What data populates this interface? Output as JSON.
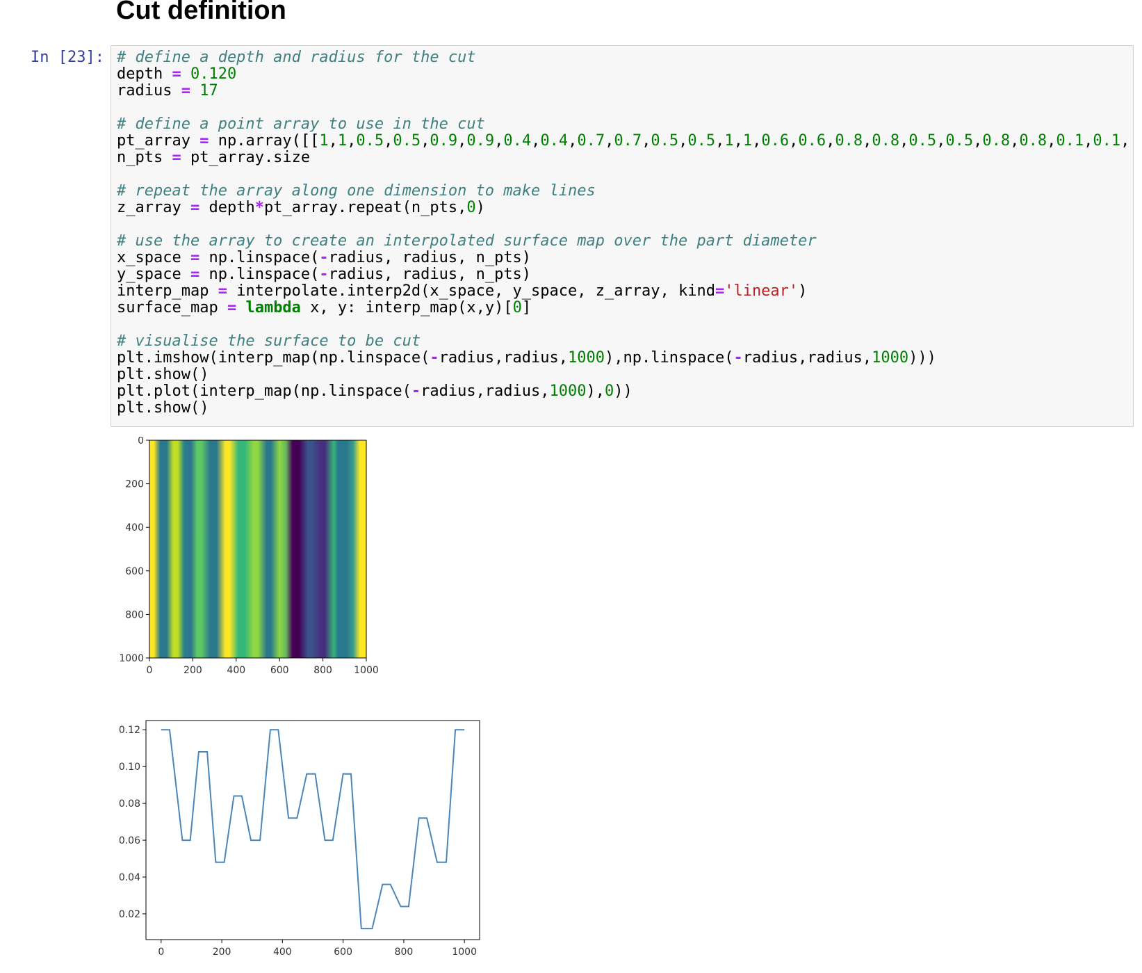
{
  "heading": "Cut definition",
  "prompt": "In [23]:",
  "code": {
    "l1": "# define a depth and radius for the cut",
    "l2": {
      "var": "depth",
      "eq": "=",
      "val": "0.120"
    },
    "l3": {
      "var": "radius",
      "eq": "=",
      "val": "17"
    },
    "l5": "# define a point array to use in the cut",
    "l6": {
      "a": "pt_array ",
      "eq": "=",
      "b": " np.array([[",
      "nums": [
        "1",
        "1",
        "0.5",
        "0.5",
        "0.9",
        "0.9",
        "0.4",
        "0.4",
        "0.7",
        "0.7",
        "0.5",
        "0.5",
        "1",
        "1",
        "0.6",
        "0.6",
        "0.8",
        "0.8",
        "0.5",
        "0.5",
        "0.8",
        "0.8",
        "0.1",
        "0.1",
        ""
      ]
    },
    "l7": {
      "a": "n_pts ",
      "eq": "=",
      "b": " pt_array.size"
    },
    "l9": "# repeat the array along one dimension to make lines",
    "l10": {
      "a": "z_array ",
      "eq": "=",
      "b": " depth",
      "op": "*",
      "c": "pt_array.repeat(n_pts,",
      "n": "0",
      "d": ")"
    },
    "l12": "# use the array to create an interpolated surface map over the part diameter",
    "l13": {
      "a": "x_space ",
      "eq": "=",
      "b": " np.linspace(",
      "m": "-",
      "c": "radius, radius, n_pts)"
    },
    "l14": {
      "a": "y_space ",
      "eq": "=",
      "b": " np.linspace(",
      "m": "-",
      "c": "radius, radius, n_pts)"
    },
    "l15": {
      "a": "interp_map ",
      "eq": "=",
      "b": " interpolate.interp2d(x_space, y_space, z_array, kind",
      "eq2": "=",
      "s": "'linear'",
      "c": ")"
    },
    "l16": {
      "a": "surface_map ",
      "eq": "=",
      "sp": " ",
      "k": "lambda",
      "b": " x, y: interp_map(x,y)[",
      "n": "0",
      "c": "]"
    },
    "l18": "# visualise the surface to be cut",
    "l19": {
      "a": "plt.imshow(interp_map(np.linspace(",
      "m1": "-",
      "b": "radius,radius,",
      "n1": "1000",
      "c": "),np.linspace(",
      "m2": "-",
      "d": "radius,radius,",
      "n2": "1000",
      "e": ")))"
    },
    "l20": "plt.show()",
    "l21": {
      "a": "plt.plot(interp_map(np.linspace(",
      "m": "-",
      "b": "radius,radius,",
      "n1": "1000",
      "c": "),",
      "n2": "0",
      "d": "))"
    },
    "l22": "plt.show()"
  },
  "imshow": {
    "colormap": "viridis",
    "x_ticks": [
      "0",
      "200",
      "400",
      "600",
      "800",
      "1000"
    ],
    "y_ticks": [
      "0",
      "200",
      "400",
      "600",
      "800",
      "1000"
    ]
  },
  "chart_data": {
    "type": "line",
    "x": [
      0,
      28,
      70,
      96,
      124,
      152,
      180,
      208,
      240,
      266,
      296,
      326,
      360,
      386,
      420,
      448,
      480,
      508,
      540,
      566,
      600,
      626,
      660,
      696,
      730,
      756,
      790,
      816,
      850,
      876,
      910,
      940,
      970,
      1000
    ],
    "y": [
      0.12,
      0.12,
      0.06,
      0.06,
      0.108,
      0.108,
      0.048,
      0.048,
      0.084,
      0.084,
      0.06,
      0.06,
      0.12,
      0.12,
      0.072,
      0.072,
      0.096,
      0.096,
      0.06,
      0.06,
      0.096,
      0.096,
      0.012,
      0.012,
      0.036,
      0.036,
      0.024,
      0.024,
      0.072,
      0.072,
      0.048,
      0.048,
      0.12,
      0.12
    ],
    "xlim": [
      -50,
      1050
    ],
    "ylim": [
      0.006,
      0.125
    ],
    "x_ticks": [
      "0",
      "200",
      "400",
      "600",
      "800",
      "1000"
    ],
    "y_ticks": [
      "0.12",
      "0.10",
      "0.08",
      "0.06",
      "0.04",
      "0.02"
    ],
    "line_color": "#4c86b9"
  }
}
